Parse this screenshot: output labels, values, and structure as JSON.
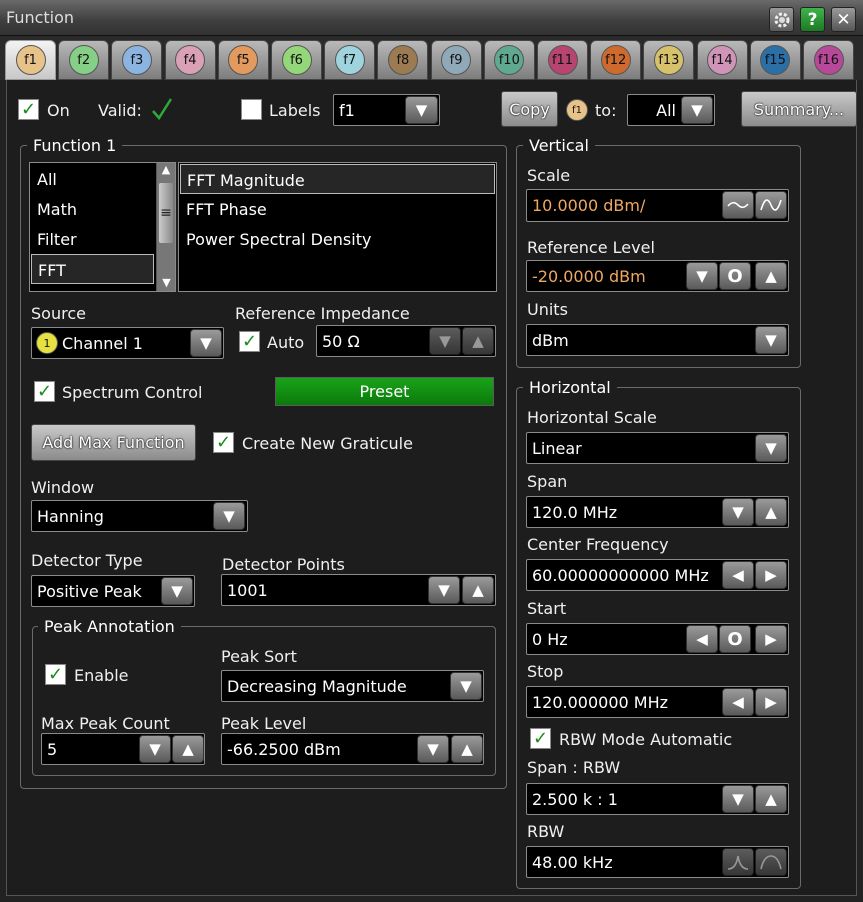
{
  "window": {
    "title": "Function"
  },
  "tabs": [
    {
      "label": "f1",
      "color": "#e7c38a"
    },
    {
      "label": "f2",
      "color": "#86cf86"
    },
    {
      "label": "f3",
      "color": "#8cb4e0"
    },
    {
      "label": "f4",
      "color": "#d9a0b6"
    },
    {
      "label": "f5",
      "color": "#e39a5e"
    },
    {
      "label": "f6",
      "color": "#94d67a"
    },
    {
      "label": "f7",
      "color": "#9fd4df"
    },
    {
      "label": "f8",
      "color": "#9c7a52"
    },
    {
      "label": "f9",
      "color": "#8fa9b9"
    },
    {
      "label": "f10",
      "color": "#5fa990"
    },
    {
      "label": "f11",
      "color": "#b84470"
    },
    {
      "label": "f12",
      "color": "#cf6a2e"
    },
    {
      "label": "f13",
      "color": "#d6c26a"
    },
    {
      "label": "f14",
      "color": "#cf94b8"
    },
    {
      "label": "f15",
      "color": "#2a6fa6"
    },
    {
      "label": "f16",
      "color": "#b8489a"
    }
  ],
  "top": {
    "on_label": "On",
    "valid_label": "Valid:",
    "labels_label": "Labels",
    "labels_value": "f1",
    "copy_label": "Copy",
    "copy_source": "f1",
    "to_label": "to:",
    "to_value": "All",
    "summary_label": "Summary..."
  },
  "function_group": {
    "title": "Function 1",
    "categories": [
      "All",
      "Math",
      "Filter",
      "FFT"
    ],
    "selected_category": "FFT",
    "operators": [
      "FFT Magnitude",
      "FFT Phase",
      "Power Spectral Density"
    ],
    "selected_operator": "FFT Magnitude",
    "source_label": "Source",
    "source_badge": "1",
    "source_value": "Channel 1",
    "ref_imp_label": "Reference Impedance",
    "auto_label": "Auto",
    "ref_imp_value": "50 Ω",
    "spectrum_control_label": "Spectrum Control",
    "preset_label": "Preset",
    "add_max_label": "Add Max Function",
    "create_graticule_label": "Create New Graticule",
    "window_label": "Window",
    "window_value": "Hanning",
    "detector_type_label": "Detector Type",
    "detector_type_value": "Positive Peak",
    "detector_points_label": "Detector Points",
    "detector_points_value": "1001"
  },
  "peak": {
    "title": "Peak Annotation",
    "enable_label": "Enable",
    "sort_label": "Peak Sort",
    "sort_value": "Decreasing Magnitude",
    "max_count_label": "Max Peak Count",
    "max_count_value": "5",
    "level_label": "Peak Level",
    "level_value": "-66.2500 dBm"
  },
  "vertical": {
    "title": "Vertical",
    "scale_label": "Scale",
    "scale_value": "10.0000 dBm/",
    "ref_level_label": "Reference Level",
    "ref_level_value": "-20.0000 dBm",
    "units_label": "Units",
    "units_value": "dBm"
  },
  "horizontal": {
    "title": "Horizontal",
    "hscale_label": "Horizontal Scale",
    "hscale_value": "Linear",
    "span_label": "Span",
    "span_value": "120.0 MHz",
    "center_label": "Center Frequency",
    "center_value": "60.00000000000 MHz",
    "start_label": "Start",
    "start_value": "0 Hz",
    "stop_label": "Stop",
    "stop_value": "120.000000 MHz",
    "rbw_auto_label": "RBW Mode Automatic",
    "span_rbw_label": "Span : RBW",
    "span_rbw_value": "2.500 k : 1",
    "rbw_label": "RBW",
    "rbw_value": "48.00 kHz"
  }
}
